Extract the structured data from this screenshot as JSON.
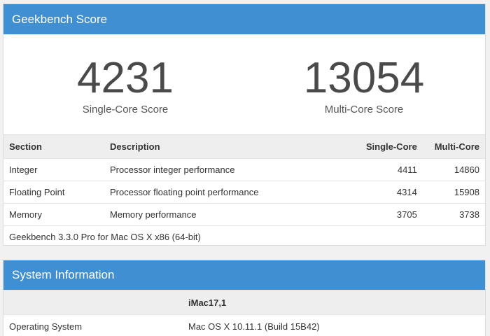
{
  "score_panel": {
    "title": "Geekbench Score",
    "single_core": {
      "value": "4231",
      "label": "Single-Core Score"
    },
    "multi_core": {
      "value": "13054",
      "label": "Multi-Core Score"
    }
  },
  "results_table": {
    "headers": [
      "Section",
      "Description",
      "Single-Core",
      "Multi-Core"
    ],
    "rows": [
      [
        "Integer",
        "Processor integer performance",
        "4411",
        "14860"
      ],
      [
        "Floating Point",
        "Processor floating point performance",
        "4314",
        "15908"
      ],
      [
        "Memory",
        "Memory performance",
        "3705",
        "3738"
      ]
    ],
    "footer": "Geekbench 3.3.0 Pro for Mac OS X x86 (64-bit)"
  },
  "system_panel": {
    "title": "System Information",
    "model": "iMac17,1",
    "rows": [
      [
        "Operating System",
        "Mac OS X 10.11.1 (Build 15B42)"
      ]
    ]
  },
  "colors": {
    "heading_blue": "#3f8fd2",
    "header_row_gray": "#eeeeee",
    "page_background": "#f1f1f1"
  }
}
